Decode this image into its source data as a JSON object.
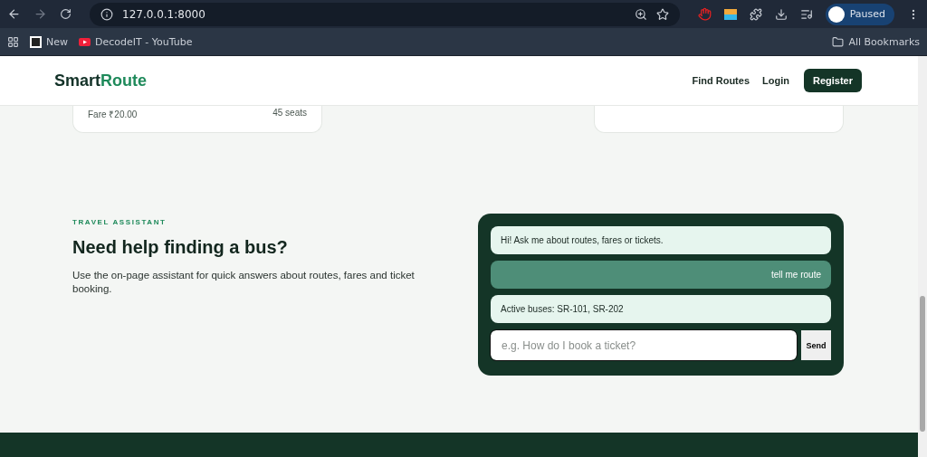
{
  "browser": {
    "url": "127.0.0.1:8000",
    "bookmarks": [
      {
        "label": "New",
        "kind": "logo"
      },
      {
        "label": "DecodeIT - YouTube",
        "kind": "youtube"
      }
    ],
    "all_bookmarks": "All Bookmarks",
    "profile": "Paused"
  },
  "header": {
    "brand_dark": "Smart",
    "brand_accent": "Route",
    "nav": [
      {
        "label": "Find Routes",
        "kind": "link"
      },
      {
        "label": "Login",
        "kind": "link"
      },
      {
        "label": "Register",
        "kind": "button"
      }
    ]
  },
  "route_cards": [
    {
      "kind": "fare",
      "fare": "Fare ₹20.00",
      "seats": "45 seats"
    },
    {
      "kind": "blank"
    }
  ],
  "assistant": {
    "eyebrow": "TRAVEL ASSISTANT",
    "title": "Need help finding a bus?",
    "description": "Use the on-page assistant for quick answers about routes, fares and ticket booking.",
    "messages": [
      {
        "kind": "bot",
        "text": "Hi! Ask me about routes, fares or tickets."
      },
      {
        "kind": "user",
        "text": "tell me route"
      },
      {
        "kind": "bot",
        "text": "Active buses: SR-101, SR-202"
      }
    ],
    "input": {
      "placeholder": "e.g. How do I book a ticket?"
    },
    "send": "Send"
  }
}
